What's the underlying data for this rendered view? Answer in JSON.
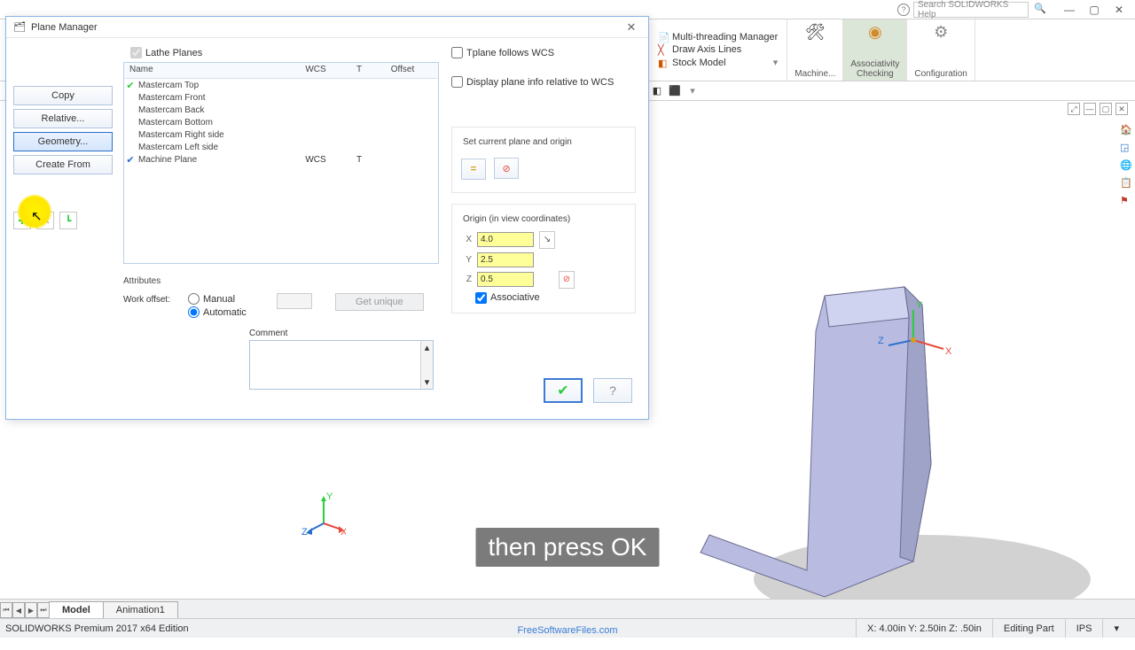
{
  "titlebar": {
    "search_placeholder": "Search SOLIDWORKS Help"
  },
  "ribbon": {
    "list": [
      {
        "label": "Multi-threading Manager"
      },
      {
        "label": "Draw Axis Lines"
      },
      {
        "label": "Stock Model"
      }
    ],
    "buttons": [
      {
        "label": "Machine..."
      },
      {
        "label": "Associativity\nChecking"
      },
      {
        "label": "Configuration"
      }
    ]
  },
  "dialog": {
    "title": "Plane Manager",
    "left_buttons": {
      "copy": "Copy",
      "relative": "Relative...",
      "geometry": "Geometry...",
      "create": "Create From"
    },
    "lathe_label": "Lathe Planes",
    "grid": {
      "headers": {
        "name": "Name",
        "wcs": "WCS",
        "t": "T",
        "offset": "Offset"
      },
      "rows": [
        {
          "name": "Mastercam Top",
          "checked": "green"
        },
        {
          "name": "Mastercam Front"
        },
        {
          "name": "Mastercam Back"
        },
        {
          "name": "Mastercam Bottom"
        },
        {
          "name": "Mastercam Right side"
        },
        {
          "name": "Mastercam Left side"
        },
        {
          "name": "Machine Plane",
          "checked": "blue",
          "wcs": "WCS",
          "t": "T"
        }
      ]
    },
    "attributes": {
      "title": "Attributes",
      "work_offset": "Work offset:",
      "manual": "Manual",
      "automatic": "Automatic",
      "get_unique": "Get unique",
      "comment": "Comment"
    },
    "right": {
      "tplane": "Tplane follows WCS",
      "display_rel": "Display plane info relative to WCS",
      "set_current": "Set current plane and origin",
      "origin_label": "Origin (in view coordinates)",
      "x": "4.0",
      "y": "2.5",
      "z": "0.5",
      "associative": "Associative"
    }
  },
  "tabs": {
    "model": "Model",
    "anim": "Animation1"
  },
  "status": {
    "edition": "SOLIDWORKS Premium 2017 x64 Edition",
    "coords": "X: 4.00in Y: 2.50in Z: .50in",
    "mode": "Editing Part",
    "units": "IPS"
  },
  "subtitle": "then press OK",
  "watermark": "FreeSoftwareFiles.com"
}
